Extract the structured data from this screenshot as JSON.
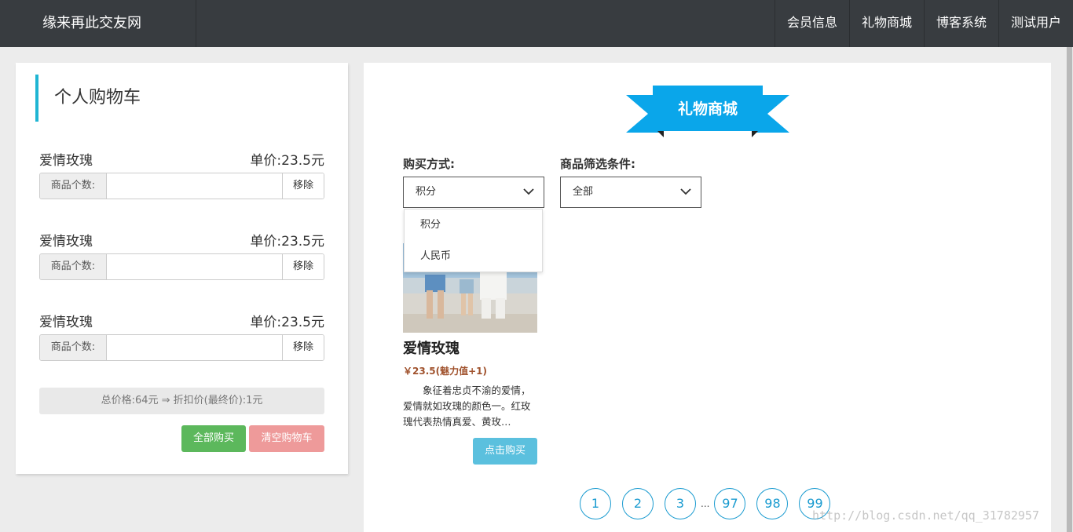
{
  "navbar": {
    "brand": "缘来再此交友网",
    "items": [
      "会员信息",
      "礼物商城",
      "博客系统",
      "测试用户"
    ]
  },
  "cart": {
    "title": "个人购物车",
    "items": [
      {
        "name": "爱情玫瑰",
        "price": "单价:23.5元",
        "qty_label": "商品个数:",
        "qty_value": "",
        "remove": "移除"
      },
      {
        "name": "爱情玫瑰",
        "price": "单价:23.5元",
        "qty_label": "商品个数:",
        "qty_value": "",
        "remove": "移除"
      },
      {
        "name": "爱情玫瑰",
        "price": "单价:23.5元",
        "qty_label": "商品个数:",
        "qty_value": "",
        "remove": "移除"
      }
    ],
    "total": "总价格:64元 ⇒ 折扣价(最终价):1元",
    "buy_all": "全部购买",
    "clear": "清空购物车"
  },
  "mall": {
    "title": "礼物商城",
    "purchase_method_label": "购买方式:",
    "purchase_method_value": "积分",
    "filter_label": "商品筛选条件:",
    "filter_value": "全部",
    "dropdown_options": [
      "积分",
      "人民币"
    ],
    "product": {
      "name": "爱情玫瑰",
      "price": "￥23.5(魅力值+1)",
      "description": "象征着忠贞不渝的爱情，爱情就如玫瑰的颜色一。红玫瑰代表热情真爱、黄玫…",
      "buy": "点击购买"
    },
    "pagination": {
      "pages_start": [
        "1",
        "2",
        "3"
      ],
      "ellipsis": "...",
      "pages_end": [
        "97",
        "98",
        "99"
      ]
    }
  },
  "watermark": "http://blog.csdn.net/qq_31782957",
  "colors": {
    "navbar": "#383c40",
    "accent": "#1fb5d3",
    "ribbon": "#0aa6ea",
    "success": "#5cb85c",
    "danger_light": "#ee9a9a",
    "info": "#5bc0de"
  }
}
